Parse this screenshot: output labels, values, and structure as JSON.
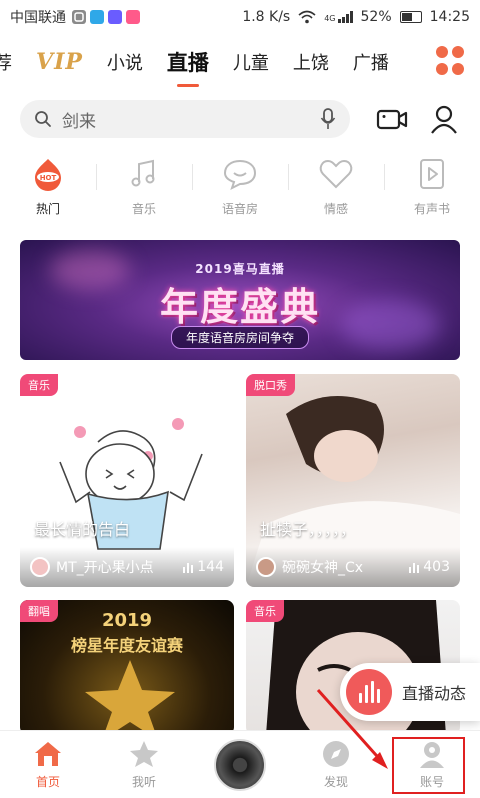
{
  "status_bar": {
    "carrier": "中国联通",
    "speed": "1.8 K/s",
    "battery": "52%",
    "time": "14:25",
    "signal": "4G"
  },
  "tabs": [
    "荐",
    "VIP",
    "小说",
    "直播",
    "儿童",
    "上饶",
    "广播"
  ],
  "active_tab": "直播",
  "search": {
    "placeholder": "剑来"
  },
  "categories": [
    {
      "label": "热门",
      "icon": "hot-icon",
      "active": true
    },
    {
      "label": "音乐",
      "icon": "music-note-icon"
    },
    {
      "label": "语音房",
      "icon": "chat-bubble-icon"
    },
    {
      "label": "情感",
      "icon": "heart-icon"
    },
    {
      "label": "有声书",
      "icon": "play-book-icon"
    }
  ],
  "banner": {
    "subtitle": "2019喜马直播",
    "title": "年度盛典",
    "tag": "年度语音房房间争夺"
  },
  "cards": [
    {
      "badge": "音乐",
      "title": "最长情的告白",
      "host": "MT_开心果小点",
      "count": "144"
    },
    {
      "badge": "脱口秀",
      "title": "扯犊子，，，，，",
      "host": "碗碗女神_Cx",
      "count": "403"
    },
    {
      "badge": "翻唱",
      "poster_year": "2019",
      "poster_text": "榜星年度友谊赛",
      "title": ""
    },
    {
      "badge": "音乐",
      "title": ""
    }
  ],
  "floating_button": {
    "label": "直播动态"
  },
  "bottom_nav": [
    {
      "label": "首页",
      "icon": "home-icon",
      "active": true
    },
    {
      "label": "我听",
      "icon": "star-icon"
    },
    {
      "label": "发现",
      "icon": "compass-icon"
    },
    {
      "label": "账号",
      "icon": "account-icon"
    }
  ],
  "colors": {
    "accent": "#f05a3a",
    "vip": "#d9a24a",
    "badge": "#f04a78",
    "annotation": "#e02020"
  }
}
